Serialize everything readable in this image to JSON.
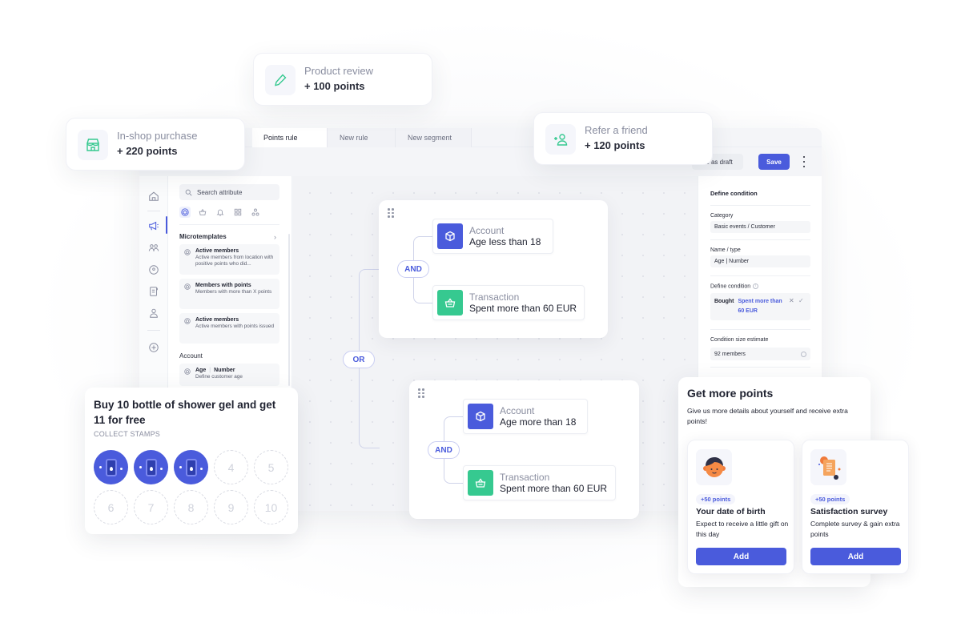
{
  "colors": {
    "accent": "#4a5bdc",
    "green": "#36c990",
    "text": "#1f2230",
    "muted": "#8a8ea0"
  },
  "floating_cards": [
    {
      "icon": "shop-icon",
      "title": "In-shop purchase",
      "points": "+ 220 points"
    },
    {
      "icon": "pencil-icon",
      "title": "Product review",
      "points": "+ 100 points"
    },
    {
      "icon": "refer-friend-icon",
      "title": "Refer a friend",
      "points": "+ 120 points"
    }
  ],
  "tabs": [
    {
      "label": "Points rule",
      "active": true
    },
    {
      "label": "New rule",
      "active": false
    },
    {
      "label": "New segment",
      "active": false
    }
  ],
  "toolbar": {
    "draft_label": "ve as draft",
    "save_label": "Save",
    "more_icon": "more-vertical-icon"
  },
  "rail": {
    "items": [
      "home-icon",
      "megaphone-icon",
      "members-icon",
      "location-icon",
      "document-icon",
      "user-icon",
      "add-circle-icon"
    ],
    "active": "megaphone-icon"
  },
  "attributes": {
    "search_placeholder": "Search attribute",
    "category_icons": [
      "cube-icon",
      "basket-icon",
      "bell-icon",
      "grid-icon",
      "nodes-icon"
    ],
    "microtemplates_title": "Microtemplates",
    "microtemplates": [
      {
        "title": "Active members",
        "desc": "Active members from location with positive points who did..."
      },
      {
        "title": "Members with points",
        "desc": "Members with more than X points"
      },
      {
        "title": "Active members",
        "desc": "Active members with points issued"
      }
    ],
    "account_title": "Account",
    "account_items": [
      {
        "name": "Age",
        "type": "Number",
        "desc": "Define customer age"
      }
    ]
  },
  "rules": {
    "or_label": "OR",
    "groups": [
      {
        "operator": "AND",
        "conditions": [
          {
            "icon": "cube-icon",
            "category": "Account",
            "value": "Age less than 18"
          },
          {
            "icon": "basket-icon",
            "category": "Transaction",
            "value": "Spent more than 60 EUR"
          }
        ]
      },
      {
        "operator": "AND",
        "conditions": [
          {
            "icon": "cube-icon",
            "category": "Account",
            "value": "Age more than 18"
          },
          {
            "icon": "basket-icon",
            "category": "Transaction",
            "value": "Spent more than 60 EUR"
          }
        ]
      }
    ]
  },
  "condition_panel": {
    "heading": "Define condition",
    "category_label": "Category",
    "category_value": "Basic events / Customer",
    "name_label": "Name / type",
    "name_value": "Age | Number",
    "define_label": "Define condition",
    "define_verb": "Bought",
    "define_value": "Spent more than 60 EUR",
    "estimate_label": "Condition size estimate",
    "estimate_value": "92 members"
  },
  "stamp_card": {
    "title": "Buy 10 bottle of shower gel and get 11 for free",
    "subtitle": "COLLECT STAMPS",
    "collected": 3,
    "total": 10,
    "empty_labels": [
      "4",
      "5",
      "6",
      "7",
      "8",
      "9",
      "10"
    ]
  },
  "get_more_points": {
    "title": "Get more points",
    "description": "Give us more details about yourself and receive extra points!",
    "offers": [
      {
        "badge": "+50 points",
        "title": "Your date of birth",
        "desc": "Expect to receive a little gift on this day",
        "button": "Add",
        "illustration": "face-avatar-icon"
      },
      {
        "badge": "+50 points",
        "title": "Satisfaction survey",
        "desc": "Complete survey & gain extra points",
        "button": "Add",
        "illustration": "survey-document-icon"
      }
    ]
  }
}
